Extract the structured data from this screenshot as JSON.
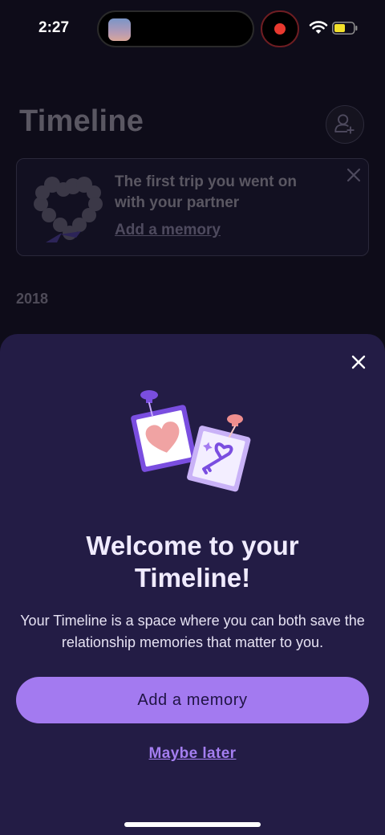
{
  "status_bar": {
    "time": "2:27",
    "icons": [
      "screen-thumbnail-icon",
      "record-icon",
      "wifi-icon",
      "battery-icon"
    ],
    "record_color": "#e8392f",
    "battery_color": "#f3e12b"
  },
  "background_page": {
    "title": "Timeline",
    "add_partner_icon": "person-plus-icon",
    "prompt_card": {
      "text": "The first trip you went on with your partner",
      "link": "Add a memory",
      "art_icon": "heart-wreath-icon",
      "close_icon": "close-icon"
    },
    "year": "2018"
  },
  "sheet": {
    "close_icon": "close-icon",
    "illustration": "pinned-photos-heart-key-icon",
    "title": "Welcome to your Timeline!",
    "description": "Your Timeline is a space where you can both save the relationship memories that matter to you.",
    "primary_button": "Add a memory",
    "secondary_link": "Maybe later"
  },
  "colors": {
    "sheet_bg": "#231c45",
    "accent": "#a37af0",
    "page_bg": "#0e0c19"
  }
}
